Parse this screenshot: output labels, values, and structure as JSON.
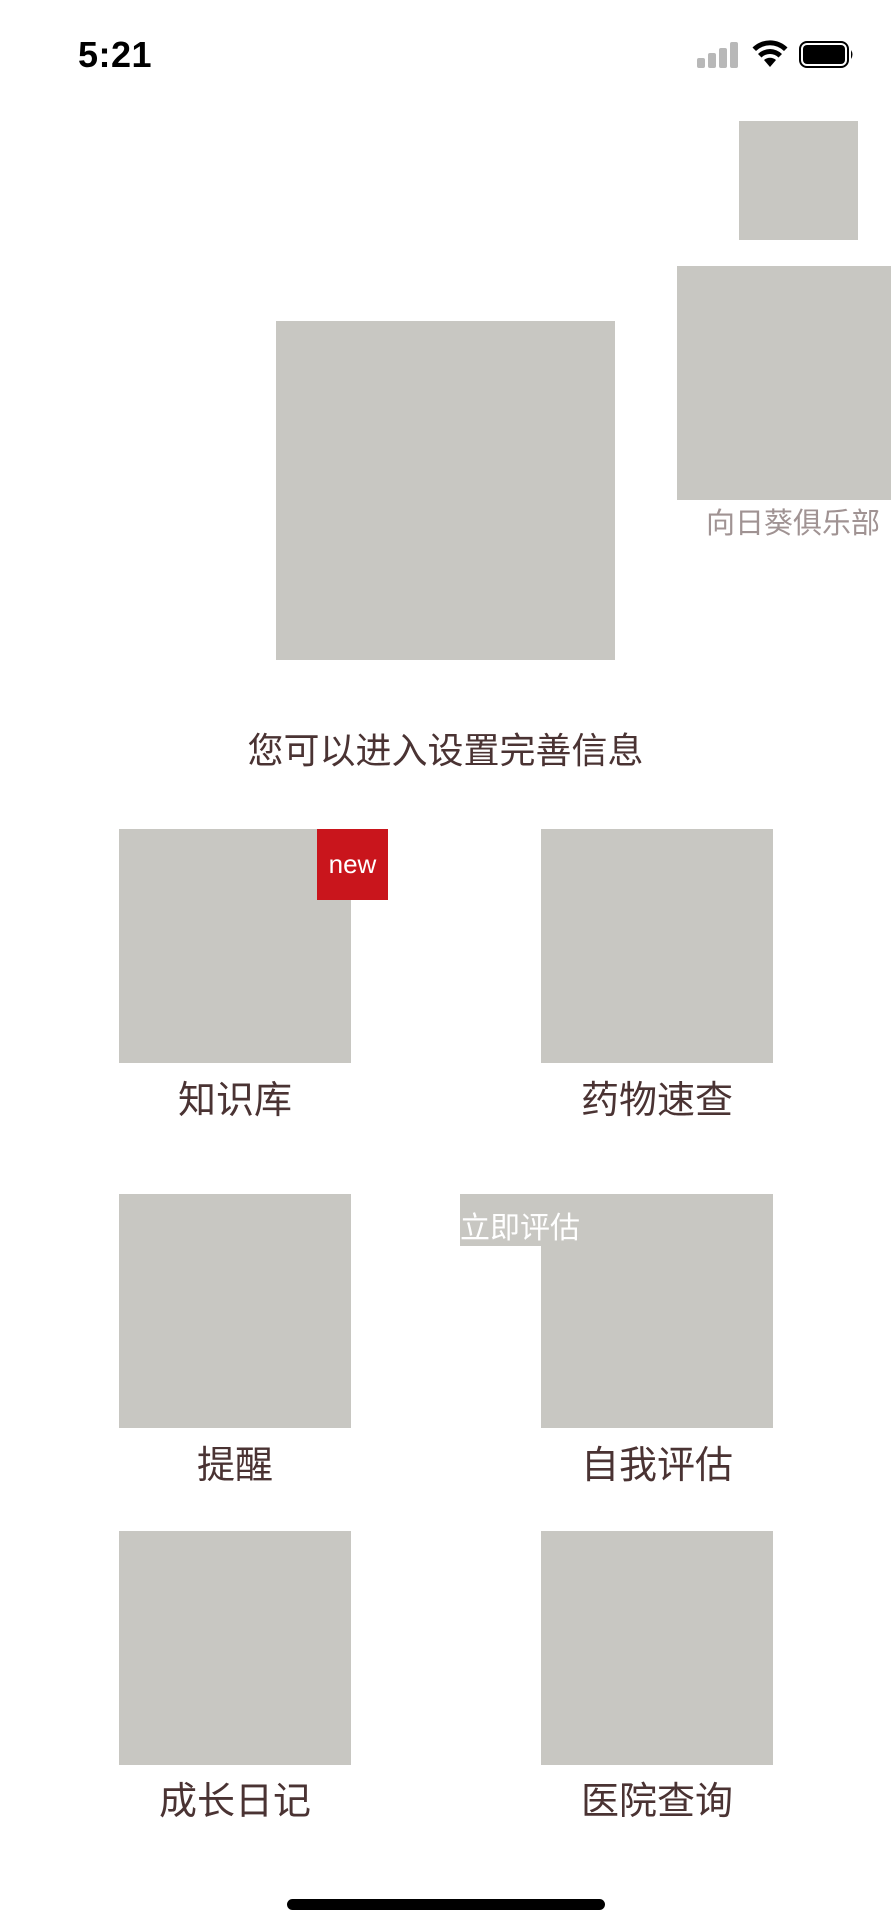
{
  "status_bar": {
    "time": "5:21",
    "icons": [
      "cellular-signal-icon",
      "wifi-icon",
      "battery-icon"
    ]
  },
  "header": {
    "club_label": "向日葵俱乐部",
    "hint": "您可以进入设置完善信息"
  },
  "grid": {
    "tiles": [
      {
        "label": "知识库",
        "badge": "new"
      },
      {
        "label": "药物速查"
      },
      {
        "label": "提醒"
      },
      {
        "label": "自我评估",
        "tag": "立即评估"
      },
      {
        "label": "成长日记"
      },
      {
        "label": "医院查询"
      }
    ]
  },
  "colors": {
    "placeholder": "#c8c7c2",
    "text": "#4a3333",
    "badge": "#c9151c",
    "club_label": "#a09393"
  }
}
